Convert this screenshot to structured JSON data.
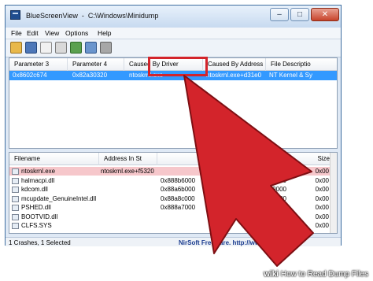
{
  "window": {
    "title": "BlueScreenView  -  C:\\Windows\\Minidump",
    "minimize_label": "–",
    "maximize_label": "□",
    "close_label": "✕"
  },
  "menu": [
    "File",
    "Edit",
    "View",
    "Options",
    "Help"
  ],
  "toolbar": {
    "buttons": [
      "open-folder-icon",
      "save-icon",
      "copy-icon",
      "properties-icon",
      "refresh-icon",
      "html-report-icon",
      "about-icon"
    ]
  },
  "crash_table": {
    "columns": [
      "Parameter 3",
      "Parameter 4",
      "Caused By Driver",
      "Caused By Address",
      "File Description"
    ],
    "header_display": [
      "Parameter 3",
      "Parameter 4",
      "Caused By Driver",
      "Caused By Address",
      "File Descriptio"
    ],
    "rows": [
      {
        "param3": "0x8602c674",
        "param4": "0x82a30320",
        "driver": "ntoskrnl.exe",
        "address": "ntoskrnl.exe+d31e0",
        "description": "NT Kernel & Sy"
      }
    ]
  },
  "driver_table": {
    "columns": [
      "Filename",
      "Address In St...",
      "From Address",
      "To Address",
      "Size"
    ],
    "header_display": [
      "Filename",
      "Address In St",
      "Size"
    ],
    "rows": [
      {
        "filename": "ntoskrnl.exe",
        "address": "ntoskrnl.exe+f5320",
        "to": "0x82c46000",
        "size": "0x00",
        "highlight": true
      },
      {
        "filename": "halmacpi.dll",
        "address": "",
        "to": "0x8285b000",
        "size": "0x00",
        "highlight": false
      },
      {
        "filename": "kdcom.dll",
        "address": "",
        "to": "0x80bb9000",
        "size": "0x00",
        "highlight": false
      },
      {
        "filename": "mcupdate_GenuineIntel.dll",
        "address": "",
        "to": "0x88a7b000",
        "size": "0x00",
        "highlight": false
      },
      {
        "filename": "PSHED.dll",
        "address": "",
        "to": "0x88a8c000",
        "size": "0x00",
        "highlight": false
      },
      {
        "filename": "BOOTVID.dll",
        "address": "",
        "to": "0x88ab3000",
        "size": "0x00",
        "highlight": false
      },
      {
        "filename": "CLFS.SYS",
        "address": "",
        "to": "0x88adf000",
        "size": "0x00",
        "highlight": false
      }
    ],
    "addr_col_clips": [
      "0x888b6000",
      "0x88a6b000",
      "0x88a8c000",
      "0x888a7000"
    ]
  },
  "status": {
    "left": "1 Crashes, 1 Selected",
    "link": "NirSoft Freeware.  http://www.nirsoft.net"
  },
  "annotation": {
    "highlight_color": "#d3242b",
    "arrow_color": "#d3242b"
  },
  "watermark": {
    "brand": "wiki",
    "text": "How to Read Dump Files"
  }
}
